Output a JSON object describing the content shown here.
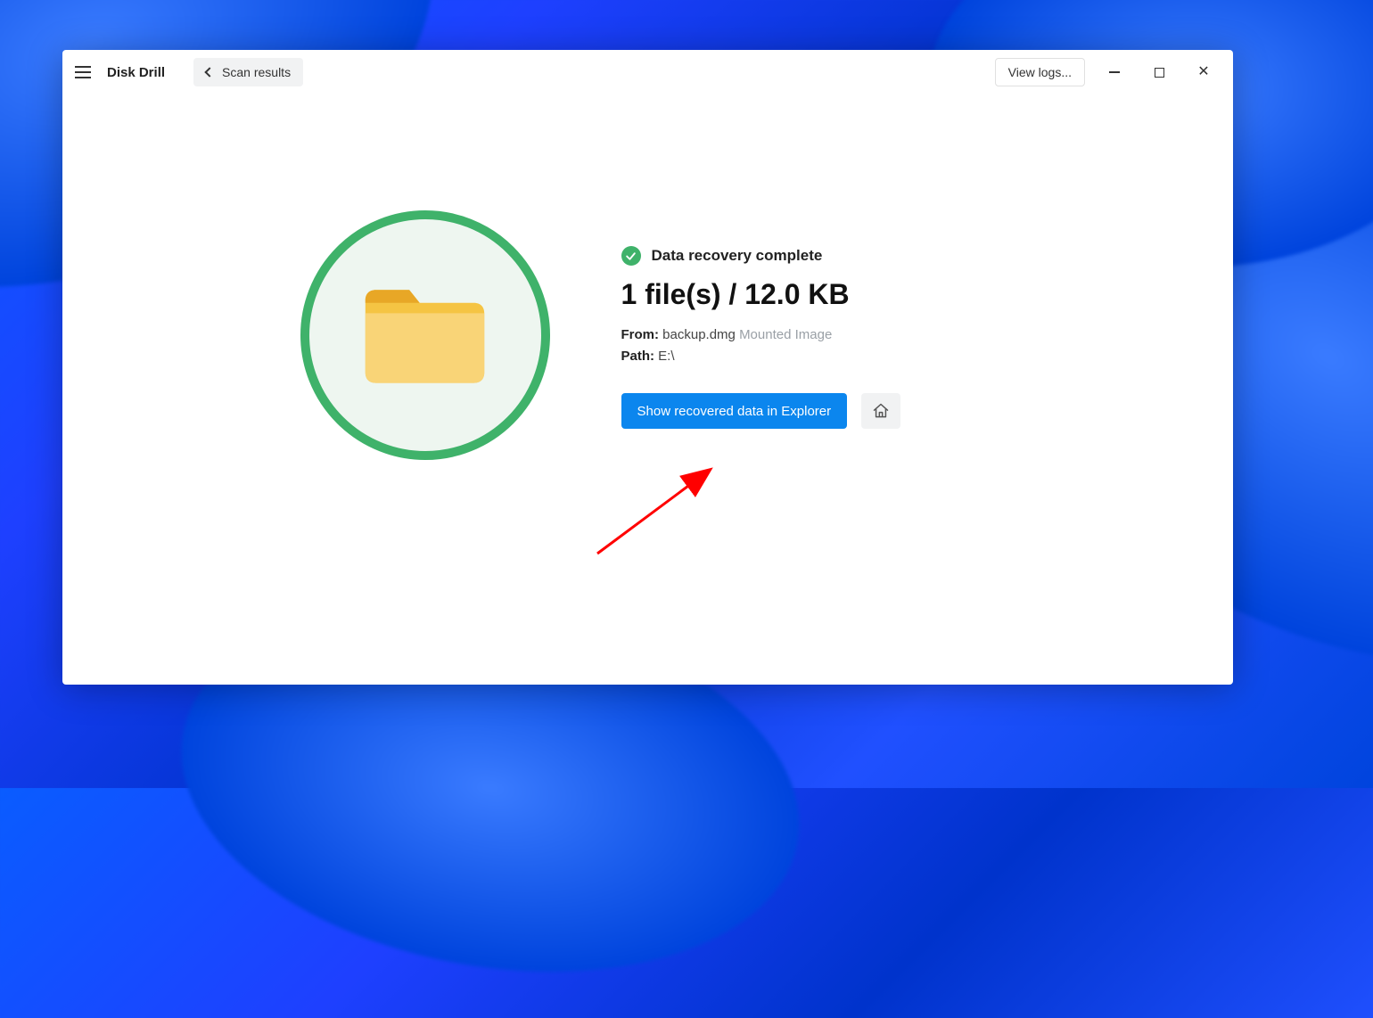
{
  "app": {
    "title": "Disk Drill"
  },
  "breadcrumb": {
    "back_label": "Scan results"
  },
  "titlebar": {
    "view_logs_label": "View logs..."
  },
  "status": {
    "heading": "Data recovery complete",
    "summary": "1 file(s) / 12.0 KB",
    "from_label": "From:",
    "from_value": "backup.dmg",
    "from_suffix": "Mounted Image",
    "path_label": "Path:",
    "path_value": "E:\\"
  },
  "actions": {
    "show_in_explorer": "Show recovered data in Explorer"
  }
}
